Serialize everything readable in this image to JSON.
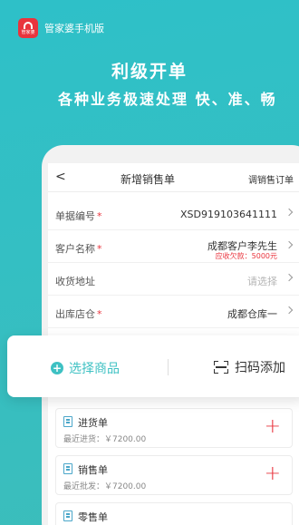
{
  "brand": {
    "logo_text": "管家婆",
    "name": "管家婆手机版"
  },
  "hero": {
    "title": "利级开单",
    "subtitle": "各种业务极速处理 快、准、畅"
  },
  "nav": {
    "back": "<",
    "title": "新增销售单",
    "link": "调销售订单"
  },
  "form": {
    "order_no": {
      "label": "单据编号",
      "required": "*",
      "value": "XSD919103641111"
    },
    "customer": {
      "label": "客户名称",
      "required": "*",
      "value": "成都客户李先生",
      "note": "应收欠款：5000元"
    },
    "address": {
      "label": "收货地址",
      "placeholder": "请选择"
    },
    "warehouse": {
      "label": "出库店仓",
      "required": "*",
      "value": "成都仓库一"
    }
  },
  "actions": {
    "select_label": "选择商品",
    "scan_label": "扫码添加"
  },
  "list": {
    "items": [
      {
        "title": "进货单",
        "sub": "最近进货：￥7200.00"
      },
      {
        "title": "销售单",
        "sub": "最近批发：￥7200.00"
      },
      {
        "title": "零售单"
      }
    ]
  },
  "colors": {
    "accent": "#3ec1c3",
    "brand_red": "#e9343d",
    "background": "#34bfc3"
  }
}
